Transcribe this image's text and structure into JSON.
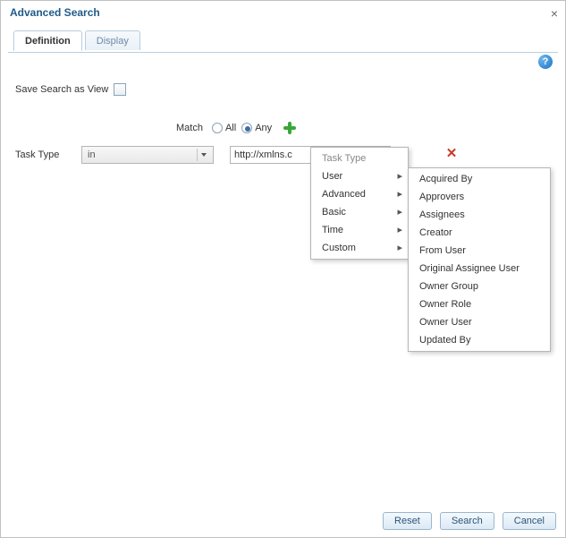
{
  "dialog": {
    "title": "Advanced Search"
  },
  "tabs": {
    "definition": "Definition",
    "display": "Display"
  },
  "panel": {
    "save_label": "Save Search as View",
    "match_label": "Match",
    "match_all": "All",
    "match_any": "Any",
    "match_selected": "any"
  },
  "criteria": {
    "field_label": "Task Type",
    "operator": "in",
    "value": "http://xmlns.c"
  },
  "menu1": {
    "title": "Task Type",
    "items": [
      "User",
      "Advanced",
      "Basic",
      "Time",
      "Custom"
    ]
  },
  "menu2": {
    "items": [
      "Acquired By",
      "Approvers",
      "Assignees",
      "Creator",
      "From User",
      "Original Assignee User",
      "Owner Group",
      "Owner Role",
      "Owner User",
      "Updated By"
    ]
  },
  "buttons": {
    "reset": "Reset",
    "search": "Search",
    "cancel": "Cancel"
  }
}
